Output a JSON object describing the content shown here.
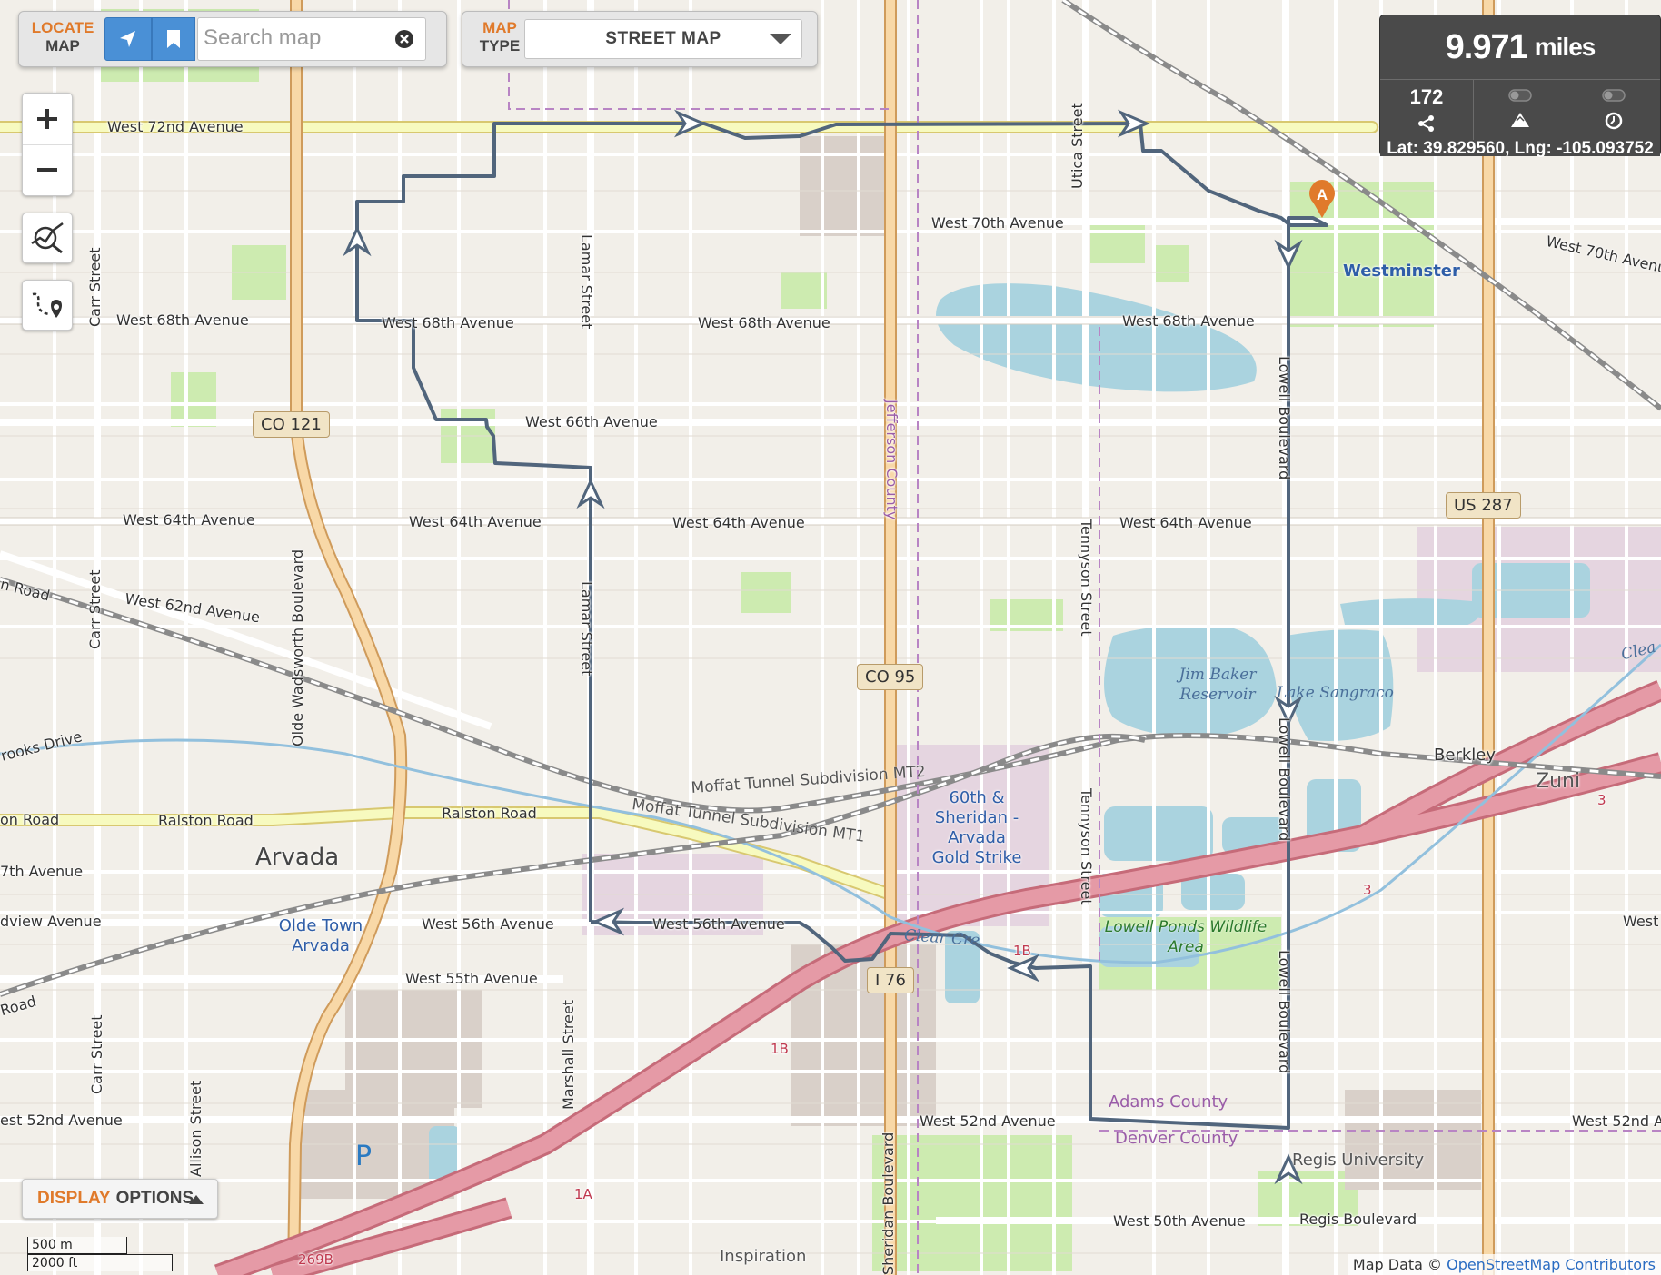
{
  "locate": {
    "label_top": "LOCATE",
    "label_bottom": "MAP",
    "search_placeholder": "Search map"
  },
  "map_type": {
    "label_top": "MAP",
    "label_bottom": "TYPE",
    "selected": "STREET MAP"
  },
  "stats": {
    "distance_value": "9.971",
    "distance_unit": "miles",
    "points": "172",
    "coords": "Lat: 39.829560, Lng: -105.093752"
  },
  "display_options": {
    "highlight": "DISPLAY",
    "rest": "OPTIONS"
  },
  "scale": {
    "metric": "500 m",
    "imperial": "2000 ft"
  },
  "attribution": {
    "prefix": "Map Data ©",
    "link": "OpenStreetMap Contributors"
  },
  "marker": {
    "letter": "A"
  },
  "colors": {
    "route": "#51657c",
    "accent": "#e07a2b",
    "button": "#4a90d6",
    "motorway": "#e0828f",
    "primary": "#f5c888",
    "water": "#aad3df"
  },
  "streets": {
    "w72": "West 72nd Avenue",
    "w70": "West 70th Avenue",
    "w70e": "West 70th Avenue",
    "w68a": "West 68th Avenue",
    "w68b": "West 68th Avenue",
    "w68c": "West 68th Avenue",
    "w68d": "West 68th Avenue",
    "w66": "West 66th Avenue",
    "w64a": "West 64th Avenue",
    "w64b": "West 64th Avenue",
    "w64c": "West 64th Avenue",
    "w64d": "West 64th Avenue",
    "w62": "West 62nd Avenue",
    "ralston_a": "Ralston Road",
    "ralston_b": "Ralston Road",
    "ralston_c": "on Road",
    "w57": "7th Avenue",
    "grandview": "dview Avenue",
    "w56a": "West 56th Avenue",
    "w56b": "West 56th Avenue",
    "w55": "West 55th Avenue",
    "w52a": "est 52nd Avenue",
    "w52b": "West 52nd Avenue",
    "w52c": "West 52nd A",
    "w50": "West 50th Avenue",
    "regis_blvd": "Regis Boulevard",
    "road_left": "n Road",
    "road_left2": "Road",
    "brooks": "rooks Drive",
    "w_right": "West",
    "carr": "Carr Street",
    "carr2": "Carr Street",
    "carr3": "Carr Street",
    "lamar": "Lamar Street",
    "lamar2": "Lamar Street",
    "olde_wads": "Olde Wadsworth Boulevard",
    "utica": "Utica Street",
    "tennyson": "Tennyson Street",
    "tennyson2": "Tennyson Street",
    "lowell": "Lowell Boulevard",
    "lowell2": "Lowell Boulevard",
    "lowell3": "Lowell Boulevard",
    "marshall": "Marshall Street",
    "allison": "Allison Street",
    "sheridan": "Sheridan Boulevard",
    "jefferson": "Jefferson County"
  },
  "shields": {
    "co121": "CO 121",
    "co95": "CO 95",
    "us287": "US 287",
    "i76": "I 76"
  },
  "railways": {
    "mt2": "Moffat Tunnel Subdivision MT2",
    "mt1": "Moffat Tunnel Subdivision MT1"
  },
  "places": {
    "westminster": "Westminster",
    "arvada": "Arvada",
    "olde_town": "Olde Town Arvada",
    "gold_strike": "60th & Sheridan - Arvada Gold Strike",
    "berkley": "Berkley",
    "zuni": "Zuni",
    "regis": "Regis University",
    "inspiration": "Inspiration"
  },
  "water": {
    "jim_baker": "Jim Baker Reservoir",
    "sangraco": "Lake Sangraco",
    "clear_creek": "Clear Cre",
    "clear_creek_e": "Clea"
  },
  "parks": {
    "lowell_ponds": "Lowell Ponds Wildlife Area"
  },
  "counties": {
    "adams": "Adams County",
    "denver": "Denver County"
  },
  "exits": {
    "e1b": "1B",
    "e1b2": "1B",
    "e1a": "1A",
    "e3": "3",
    "e3b": "3",
    "e269b": "269B"
  },
  "parking": "P"
}
